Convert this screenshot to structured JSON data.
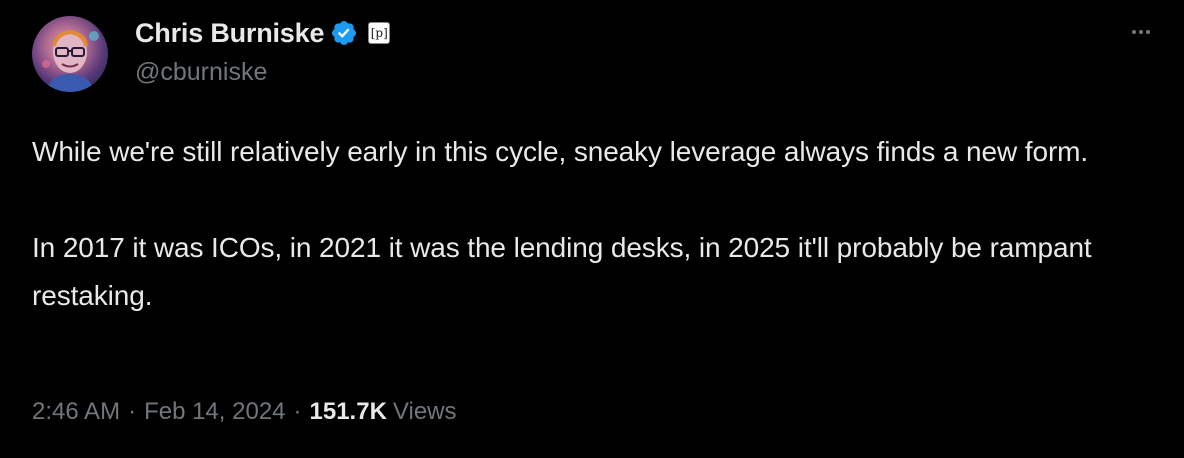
{
  "author": {
    "display_name": "Chris Burniske",
    "handle": "@cburniske",
    "verified": true,
    "affiliate_badge_icon": "p-square-badge-icon"
  },
  "tweet": {
    "paragraphs": [
      "While we're still relatively early in this cycle, sneaky leverage always finds a new form.",
      "In 2017 it was ICOs, in 2021 it was the lending desks, in 2025 it'll probably be rampant restaking."
    ],
    "time": "2:46 AM",
    "separator": "·",
    "date": "Feb 14, 2024",
    "views_count": "151.7K",
    "views_label": "Views"
  },
  "colors": {
    "background": "#000000",
    "primary_text": "#e7e9ea",
    "secondary_text": "#71767b",
    "verified_blue": "#1d9bf0"
  }
}
